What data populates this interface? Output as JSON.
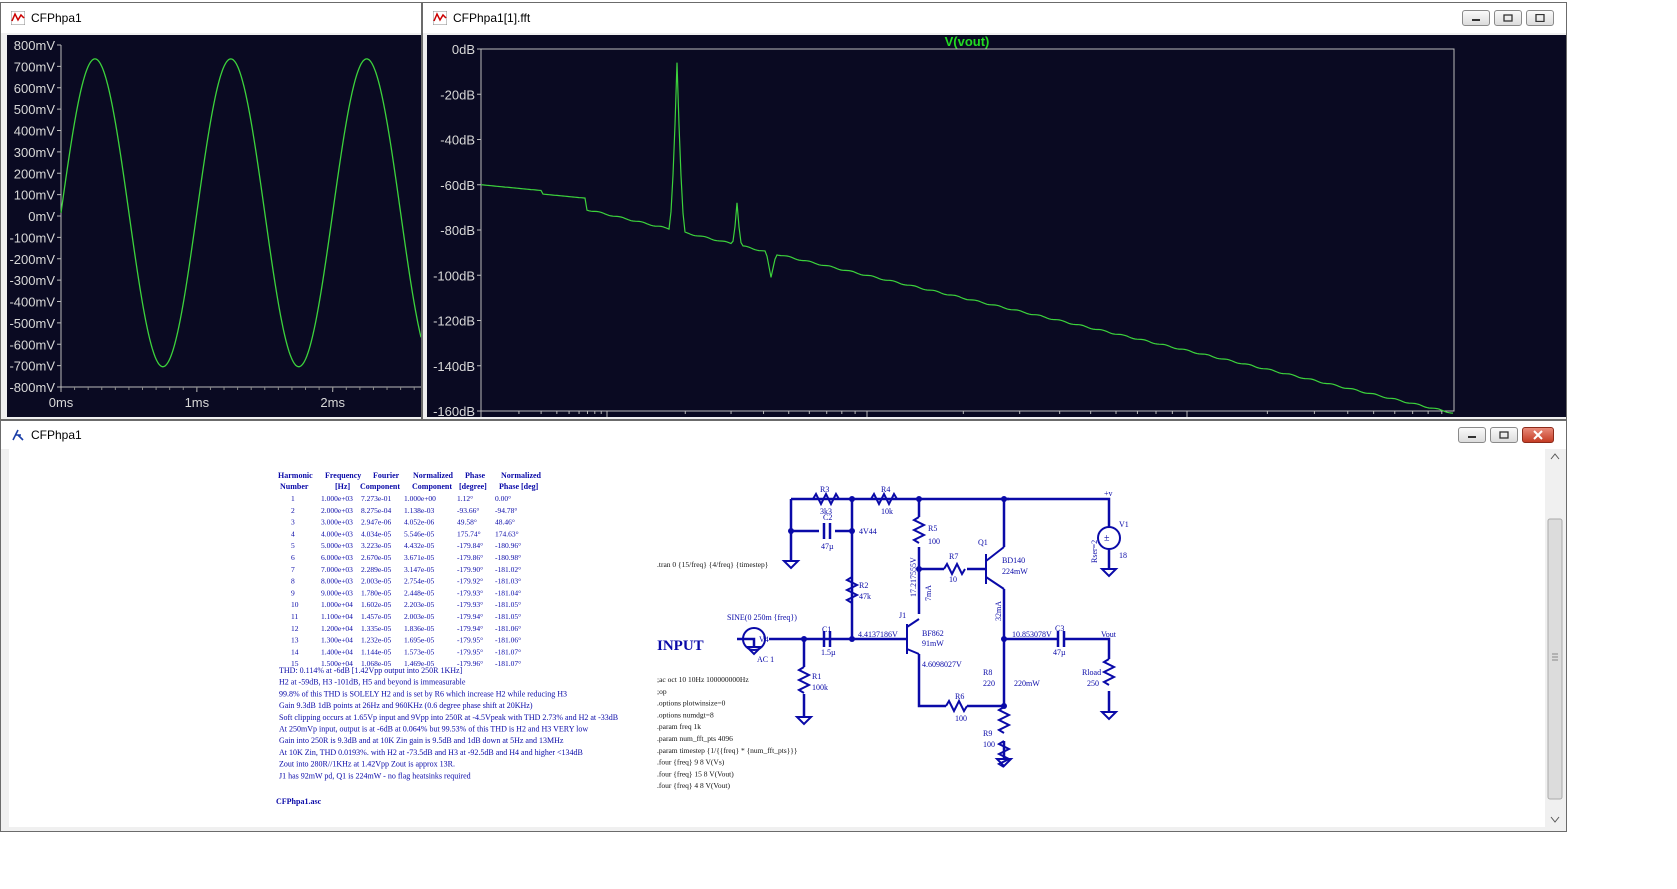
{
  "windows": {
    "transient": {
      "title": "CFPhpa1"
    },
    "fft": {
      "title": "CFPhpa1[1].fft",
      "trace": "V(vout)"
    },
    "schematic": {
      "title": "CFPhpa1"
    }
  },
  "transient_axis": {
    "y_ticks": [
      "800mV",
      "700mV",
      "600mV",
      "500mV",
      "400mV",
      "300mV",
      "200mV",
      "100mV",
      "0mV",
      "-100mV",
      "-200mV",
      "-300mV",
      "-400mV",
      "-500mV",
      "-600mV",
      "-700mV",
      "-800mV"
    ],
    "x_ticks": [
      "0ms",
      "1ms",
      "2ms"
    ]
  },
  "fft_axis": {
    "y_ticks": [
      "0dB",
      "-20dB",
      "-40dB",
      "-60dB",
      "-80dB",
      "-100dB",
      "-120dB",
      "-140dB",
      "-160dB"
    ]
  },
  "chart_data": [
    {
      "type": "line",
      "series": [
        {
          "name": "",
          "freq_hz": 1000,
          "amplitude_mv": 720
        }
      ],
      "ylim": [
        -800,
        800
      ],
      "xlim_ms": [
        0,
        2.65
      ]
    },
    {
      "type": "line",
      "title": "V(vout)",
      "series": [
        {
          "name": "V(vout)",
          "peaks_db": [
            -6,
            -80,
            -101
          ]
        }
      ],
      "ylim": [
        -160,
        0
      ]
    }
  ],
  "fourier": {
    "headers1": [
      "Harmonic",
      "Frequency",
      "Fourier",
      "Normalized",
      "Phase",
      "Normalized"
    ],
    "headers2": [
      "Number",
      "[Hz]",
      "Component",
      "Component",
      "[degree]",
      "Phase [deg]"
    ],
    "rows": [
      [
        "1",
        "1.000e+03",
        "7.273e-01",
        "1.000e+00",
        "1.12°",
        "0.00°"
      ],
      [
        "2",
        "2.000e+03",
        "8.275e-04",
        "1.138e-03",
        "-93.66°",
        "-94.78°"
      ],
      [
        "3",
        "3.000e+03",
        "2.947e-06",
        "4.052e-06",
        "49.58°",
        "48.46°"
      ],
      [
        "4",
        "4.000e+03",
        "4.034e-05",
        "5.546e-05",
        "175.74°",
        "174.63°"
      ],
      [
        "5",
        "5.000e+03",
        "3.223e-05",
        "4.432e-05",
        "-179.84°",
        "-180.96°"
      ],
      [
        "6",
        "6.000e+03",
        "2.670e-05",
        "3.671e-05",
        "-179.86°",
        "-180.98°"
      ],
      [
        "7",
        "7.000e+03",
        "2.289e-05",
        "3.147e-05",
        "-179.90°",
        "-181.02°"
      ],
      [
        "8",
        "8.000e+03",
        "2.003e-05",
        "2.754e-05",
        "-179.92°",
        "-181.03°"
      ],
      [
        "9",
        "9.000e+03",
        "1.780e-05",
        "2.448e-05",
        "-179.93°",
        "-181.04°"
      ],
      [
        "10",
        "1.000e+04",
        "1.602e-05",
        "2.203e-05",
        "-179.93°",
        "-181.05°"
      ],
      [
        "11",
        "1.100e+04",
        "1.457e-05",
        "2.003e-05",
        "-179.94°",
        "-181.05°"
      ],
      [
        "12",
        "1.200e+04",
        "1.335e-05",
        "1.836e-05",
        "-179.94°",
        "-181.06°"
      ],
      [
        "13",
        "1.300e+04",
        "1.232e-05",
        "1.695e-05",
        "-179.95°",
        "-181.06°"
      ],
      [
        "14",
        "1.400e+04",
        "1.144e-05",
        "1.573e-05",
        "-179.95°",
        "-181.07°"
      ],
      [
        "15",
        "1.500e+04",
        "1.068e-05",
        "1.469e-05",
        "-179.96°",
        "-181.07°"
      ]
    ]
  },
  "notes": [
    "THD:   0.114% at -6dB [1.42Vpp output into 250R 1KHz]",
    "H2 at -59dB, H3 -101dB,  H5 and beyond is immeasurable",
    "99.8% of this THD is SOLELY H2 and is set by R6 which increase H2 while reducing H3",
    "Gain 9.3dB 1dB points at 26Hz and 960KHz (0.6 degree phase shift at 20KHz)",
    "Soft clipping occurs at 1.65Vp input and 9Vpp into 250R at -4.5Vpeak with THD 2.73% and H2 at -33dB",
    "At 250mVp input, output is at -6dB at 0.064% but 99.53% of this THD is H2 and H3 VERY low",
    "Gain into 250R is 9.3dB and at 10K Zin gain is 9.5dB and 1dB down at 5Hz and 13MHz",
    "At 10K Zin, THD 0.0193%. with H2 at -73.5dB and H3 at -92.5dB and H4 and higher <134dB",
    "Zout into 280R//1KHz at 1.42Vpp Zout is approx 13R.",
    "J1 has 92mW pd, Q1 is 224mW - no flag heatsinks required"
  ],
  "filename": "CFPhpa1.asc",
  "directives": {
    "tran": ".tran 0 {15/freq} {4/freq} {timestep}",
    "list": [
      ";ac oct 10 10Hz 100000000Hz",
      ";op",
      ".options plotwinsize=0",
      ".options numdgt=8",
      ".param freq 1k",
      ".param num_fft_pts 4096",
      ".param timestep {1/{{freq} * {num_fft_pts}}}",
      ".four {freq} 9 8 V(Vs)",
      ".four {freq} 15 8 V(Vout)",
      ".four {freq} 4 8 V(Vout)"
    ]
  },
  "schematic": {
    "input_label": "INPUT",
    "components": {
      "R3": {
        "name": "R3",
        "value": "3k3"
      },
      "R4": {
        "name": "R4",
        "value": "10k"
      },
      "C2": {
        "name": "C2",
        "value": "47µ"
      },
      "R5": {
        "name": "R5",
        "value": "100"
      },
      "R7": {
        "name": "R7",
        "value": "10"
      },
      "R2": {
        "name": "R2",
        "value": "47k"
      },
      "Q1": {
        "name": "Q1",
        "model": "BD140",
        "power": "224mW"
      },
      "J1": {
        "name": "J1",
        "model": "BF862",
        "power": "91mW"
      },
      "C1": {
        "name": "C1",
        "value": "1.5µ"
      },
      "R1": {
        "name": "R1",
        "value": "100k"
      },
      "V4": {
        "name": "V4",
        "value": "SINE(0 250m {freq})",
        "ac": "AC 1"
      },
      "R8": {
        "name": "R8",
        "value": "220"
      },
      "R6": {
        "name": "R6",
        "value": "100"
      },
      "R9": {
        "name": "R9",
        "value": "100"
      },
      "C3": {
        "name": "C3",
        "value": "47µ"
      },
      "Rload": {
        "name": "Rload",
        "value": "250"
      },
      "V1": {
        "name": "V1",
        "value": "18",
        "rser": "Rser=2"
      }
    },
    "node_labels": {
      "n4v44": "4V44",
      "n_gate": "4.4137186V",
      "n_drain": "17.217555V",
      "i_drain": "7mA",
      "i_q1": "32mA",
      "n_source": "4.6098027V",
      "n_out": "10.853078V",
      "p_r8": "220mW",
      "vplus": "+v",
      "vout": "Vout"
    }
  },
  "colors": {
    "trace": "#3cd23c",
    "plot_bg": "#0a0a22",
    "wire": "#0a0aa8",
    "trace_title": "#22dd22"
  }
}
